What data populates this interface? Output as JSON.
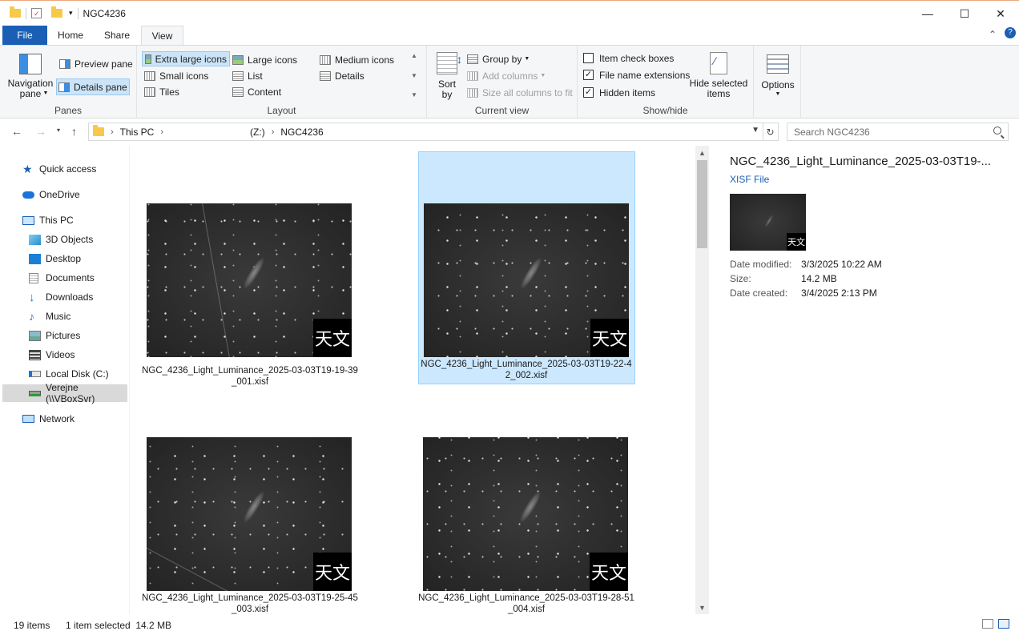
{
  "window": {
    "title": "NGC4236",
    "minimize": "—",
    "maximize": "☐",
    "close": "✕"
  },
  "ribbon_tabs": {
    "file": "File",
    "home": "Home",
    "share": "Share",
    "view": "View",
    "collapse": "⌃",
    "help": "?"
  },
  "ribbon": {
    "panes": {
      "label": "Panes",
      "navigation_pane": "Navigation pane",
      "preview_pane": "Preview pane",
      "details_pane": "Details pane"
    },
    "layout": {
      "label": "Layout",
      "extra_large_icons": "Extra large icons",
      "large_icons": "Large icons",
      "medium_icons": "Medium icons",
      "small_icons": "Small icons",
      "list": "List",
      "details": "Details",
      "tiles": "Tiles",
      "content": "Content"
    },
    "current_view": {
      "label": "Current view",
      "sort_by": "Sort by",
      "group_by": "Group by",
      "add_columns": "Add columns",
      "size_all_columns": "Size all columns to fit"
    },
    "show_hide": {
      "label": "Show/hide",
      "item_check_boxes": "Item check boxes",
      "file_name_extensions": "File name extensions",
      "hidden_items": "Hidden items",
      "hide_selected_items": "Hide selected items",
      "item_check_boxes_checked": false,
      "file_name_extensions_checked": true,
      "hidden_items_checked": true
    },
    "options": "Options"
  },
  "address": {
    "crumbs": [
      "This PC",
      "(Z:)",
      "NGC4236"
    ],
    "search_placeholder": "Search NGC4236"
  },
  "nav": {
    "quick_access": "Quick access",
    "onedrive": "OneDrive",
    "this_pc": "This PC",
    "objects_3d": "3D Objects",
    "desktop": "Desktop",
    "documents": "Documents",
    "downloads": "Downloads",
    "music": "Music",
    "pictures": "Pictures",
    "videos": "Videos",
    "local_disk": "Local Disk (C:)",
    "verejne": "Verejne (\\\\VBoxSvr)",
    "network": "Network"
  },
  "files": [
    {
      "name": "NGC_4236_Light_Luminance_2025-03-03T19-19-39_001.xisf",
      "badge": "天文",
      "selected": false
    },
    {
      "name": "NGC_4236_Light_Luminance_2025-03-03T19-22-42_002.xisf",
      "badge": "天文",
      "selected": true
    },
    {
      "name": "NGC_4236_Light_Luminance_2025-03-03T19-25-45_003.xisf",
      "badge": "天文",
      "selected": false
    },
    {
      "name": "NGC_4236_Light_Luminance_2025-03-03T19-28-51_004.xisf",
      "badge": "天文",
      "selected": false
    }
  ],
  "details": {
    "title": "NGC_4236_Light_Luminance_2025-03-03T19-...",
    "type": "XISF File",
    "badge": "天文",
    "date_modified_label": "Date modified:",
    "date_modified": "3/3/2025 10:22 AM",
    "size_label": "Size:",
    "size": "14.2 MB",
    "date_created_label": "Date created:",
    "date_created": "3/4/2025 2:13 PM"
  },
  "status": {
    "items": "19 items",
    "selected": "1 item selected  14.2 MB"
  }
}
